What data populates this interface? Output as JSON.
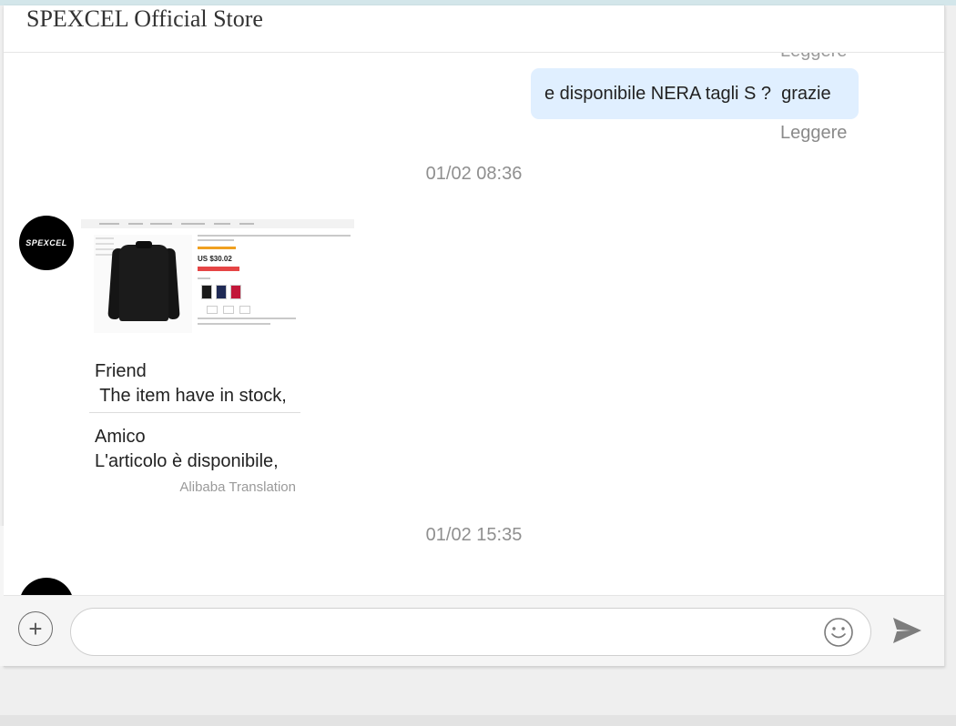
{
  "window": {
    "title": "SPEXCEL Official Store"
  },
  "messages": {
    "read_cut": "Leggere",
    "outgoing_text": "e disponibile NERA tagli S ?  grazie",
    "read_status": "Leggere",
    "timestamp_1": "01/02 08:36",
    "avatar_text": "SPEXCEL",
    "product_price": "US $30.02",
    "reply": {
      "line1": "Friend",
      "line2": " The item have in stock,",
      "line3": "Amico",
      "line4": "L'articolo è disponibile,",
      "translation_note": "Alibaba Translation"
    },
    "timestamp_2": "01/02 15:35"
  },
  "composer": {
    "plus_label": "+",
    "input_value": "",
    "input_placeholder": "",
    "emoji_icon": "smiley-icon",
    "send_icon": "send-arrow-icon"
  },
  "colors": {
    "outgoing_bubble": "#e0efff",
    "muted_text": "#8f8f8f",
    "avatar_bg": "#000000"
  }
}
